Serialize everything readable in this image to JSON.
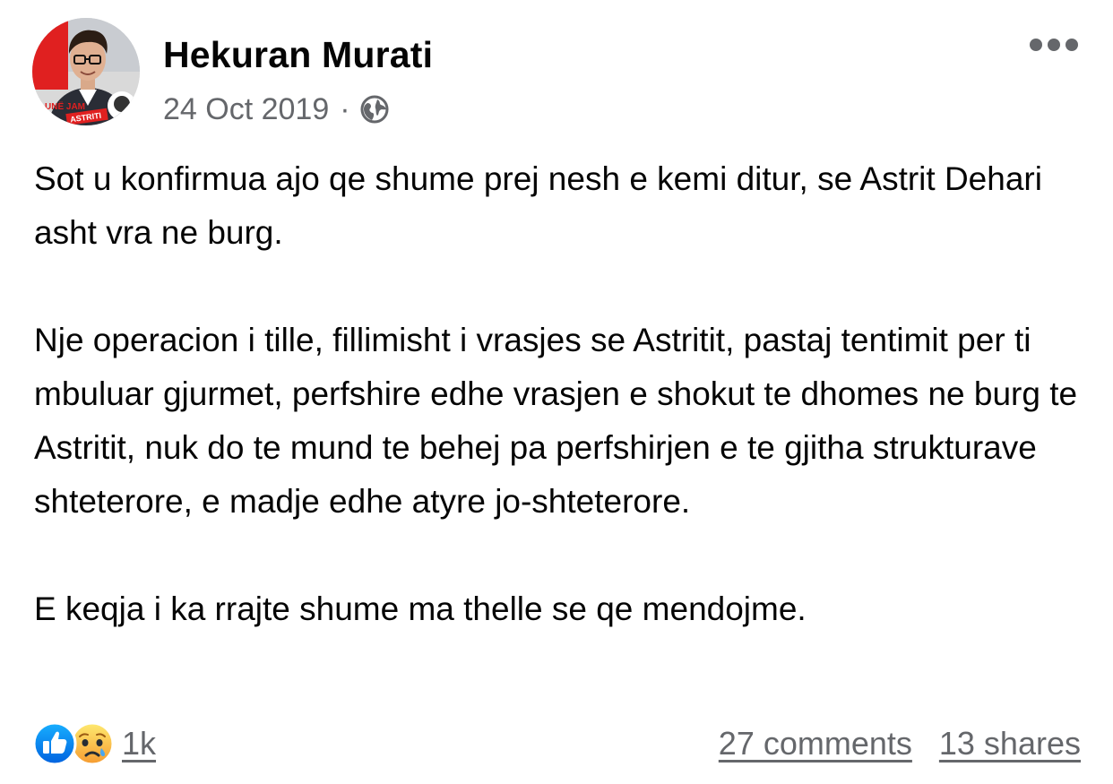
{
  "post": {
    "author": {
      "name": "Hekuran Murati",
      "avatar_badge_line1": "UNË JAM",
      "avatar_badge_line2": "ASTRITI"
    },
    "date": "24 Oct 2019",
    "separator": "·",
    "privacy_icon": "globe-icon",
    "more_icon": "more-horizontal-icon",
    "paragraphs": [
      "Sot u konfirmua ajo qe shume prej nesh e kemi ditur, se Astrit Dehari asht vra ne burg.",
      "Nje operacion i tille, fillimisht i vrasjes se Astritit, pastaj tentimit per ti mbuluar gjurmet, perfshire edhe vrasjen e shokut te dhomes ne burg te Astritit, nuk do te mund te behej pa perfshirjen e te gjitha strukturave shteterore, e madje edhe atyre jo-shteterore.",
      "E keqja i ka rrajte shume ma thelle se qe mendojme."
    ],
    "reactions": {
      "icons": [
        "like-icon",
        "sad-icon"
      ],
      "count": "1k"
    },
    "comments_label": "27 comments",
    "shares_label": "13 shares",
    "colors": {
      "text": "#050505",
      "secondary": "#65676b",
      "like_blue": "#1877f2",
      "sad_yellow": "#f7b928",
      "avatar_red": "#e02020"
    }
  }
}
